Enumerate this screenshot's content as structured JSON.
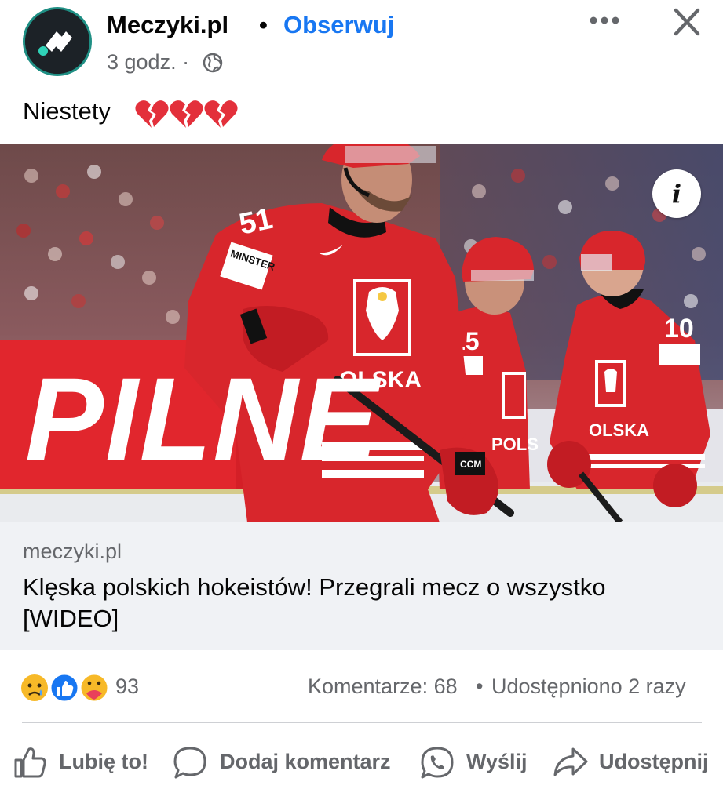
{
  "header": {
    "page_name": "Meczyki.pl",
    "separator": "•",
    "follow_label": "Obserwuj",
    "time": "3 godz. ·",
    "audience_icon": "globe-icon",
    "more_icon": "more-options-icon",
    "close_icon": "close-icon"
  },
  "post": {
    "text": "Niestety",
    "emoji": "broken-heart x3"
  },
  "image": {
    "overlay_text": "PILNE",
    "info_label": "i",
    "jersey_text": "POLSKA",
    "number_main": "51",
    "number_mid": "15",
    "number_right": "10",
    "sponsor_text": "MINSTER",
    "stick_brand": "CCM"
  },
  "link": {
    "domain": "meczyki.pl",
    "title": "Klęska polskich hokeistów! Przegrali mecz o wszystko [WIDEO]"
  },
  "stats": {
    "reaction_icons": [
      "sad-reaction-icon",
      "like-reaction-icon",
      "care-reaction-icon"
    ],
    "reaction_count": "93",
    "comments": "Komentarze: 68",
    "dot": "•",
    "shares": "Udostępniono 2 razy"
  },
  "actions": {
    "like": "Lubię to!",
    "comment": "Dodaj komentarz",
    "send": "Wyślij",
    "share": "Udostępnij"
  },
  "colors": {
    "brand_blue": "#1877f2",
    "secondary_text": "#65676b",
    "pilne_red": "#e1262d",
    "jersey_red": "#d8262c"
  }
}
